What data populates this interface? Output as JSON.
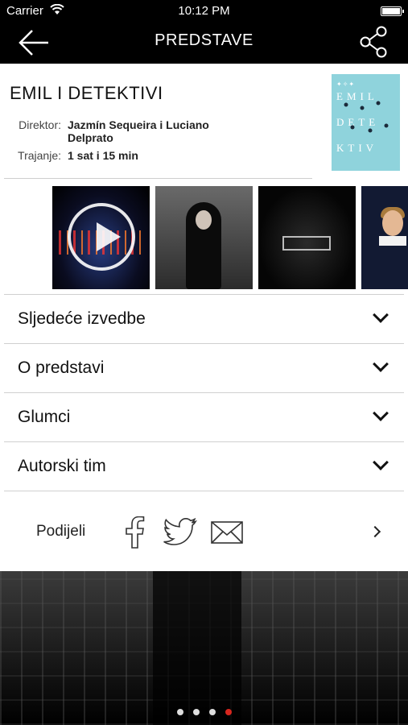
{
  "status_bar": {
    "carrier": "Carrier",
    "time": "10:12 PM"
  },
  "nav": {
    "title": "PREDSTAVE",
    "back_icon": "arrow-left-icon",
    "share_icon": "share-icon"
  },
  "play": {
    "title": "EMIL I DETEKTIVI",
    "director_label": "Direktor:",
    "director_value": "Jazmín Sequeira i Luciano Delprato",
    "duration_label": "Trajanje:",
    "duration_value": "1 sat i 15 min",
    "poster": {
      "color": "#8fd3dc",
      "line1": "EMIL",
      "line2": "DETE",
      "line3": "KTIV"
    }
  },
  "gallery": {
    "items": [
      "video",
      "photo",
      "photo",
      "photo"
    ]
  },
  "accordion": [
    {
      "label": "Sljedeće izvedbe"
    },
    {
      "label": "O predstavi"
    },
    {
      "label": "Glumci"
    },
    {
      "label": "Autorski tim"
    }
  ],
  "share": {
    "label": "Podijeli",
    "icons": [
      "facebook-icon",
      "twitter-icon",
      "mail-icon"
    ]
  },
  "pager": {
    "count": 4,
    "active_index": 3,
    "active_color": "#d7261e"
  }
}
